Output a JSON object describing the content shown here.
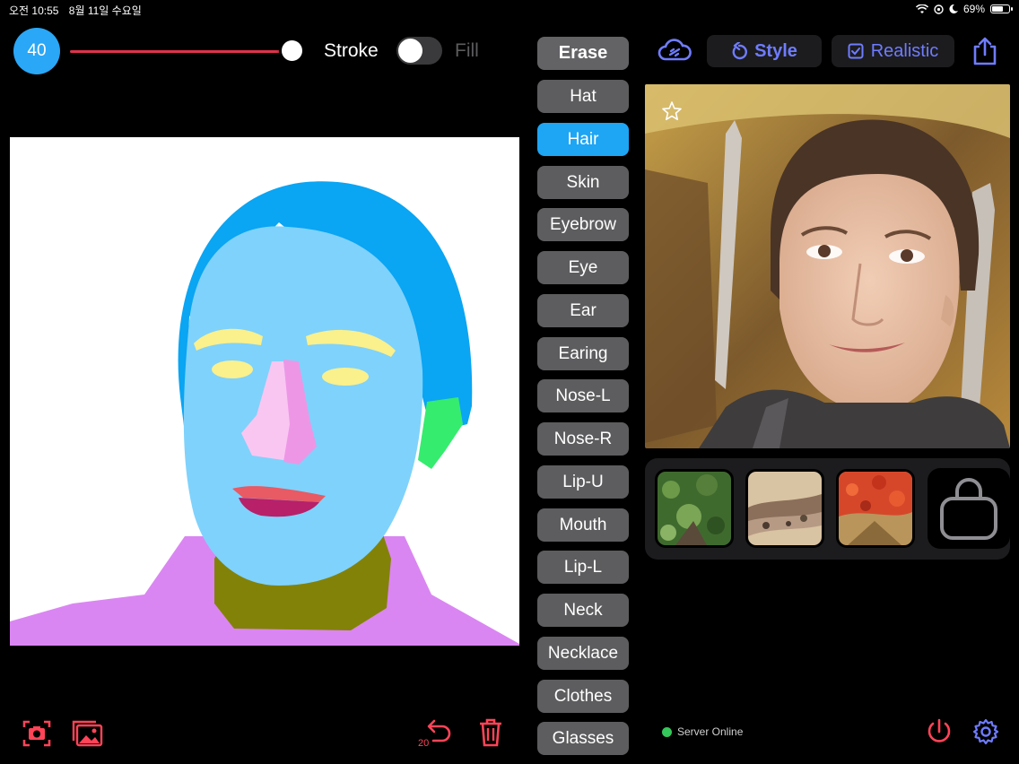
{
  "status_bar": {
    "time": "오전 10:55",
    "date": "8월 11일 수요일",
    "battery": "69%",
    "battery_level": 0.69
  },
  "brush": {
    "size": "40",
    "slider_value": 40,
    "stroke_label": "Stroke",
    "fill_label": "Fill",
    "fill_enabled": false
  },
  "labels": {
    "erase": "Erase",
    "items": [
      "Hat",
      "Hair",
      "Skin",
      "Eyebrow",
      "Eye",
      "Ear",
      "Earing",
      "Nose-L",
      "Nose-R",
      "Lip-U",
      "Mouth",
      "Lip-L",
      "Neck",
      "Necklace",
      "Clothes",
      "Glasses"
    ],
    "selected": "Hair"
  },
  "top_bar": {
    "style_label": "Style",
    "realistic_label": "Realistic"
  },
  "bottom": {
    "server_status": "Server Online",
    "undo_count": "20"
  },
  "icons": {
    "camera": "camera-icon",
    "gallery": "gallery-icon",
    "undo": "undo-icon",
    "trash": "trash-icon",
    "cloud": "cloud-link-icon",
    "style": "refresh-icon",
    "realistic": "checkbox-icon",
    "share": "share-icon",
    "star": "star-icon",
    "power": "power-icon",
    "settings": "gear-icon",
    "bag": "bag-icon"
  },
  "colors": {
    "accent_red": "#ff4458",
    "accent_blue": "#1ea5f4",
    "accent_indigo": "#6f7cff",
    "online_green": "#34c759",
    "seg_hair": "#0aa5f3",
    "seg_skin": "#7fd2fb",
    "seg_eyebrow": "#faf08c",
    "seg_eye": "#faf08c",
    "seg_ear": "#35ec6e",
    "seg_nose_l": "#f9c6f2",
    "seg_nose_r": "#ee96e6",
    "seg_lip_u": "#e85a64",
    "seg_lip_l": "#b8206a",
    "seg_neck": "#838208",
    "seg_clothes": "#da86f2"
  }
}
